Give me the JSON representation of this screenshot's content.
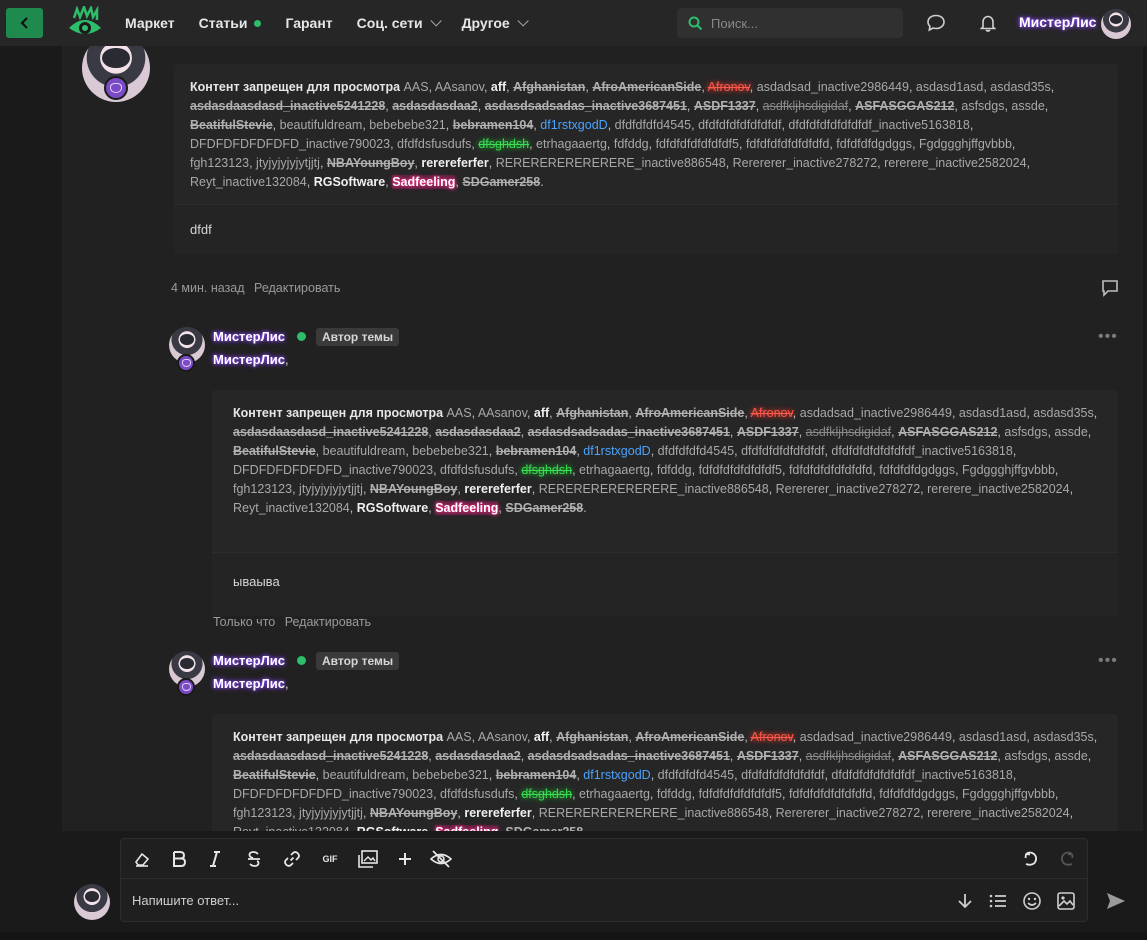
{
  "topbar": {
    "nav": [
      {
        "label": "Маркет"
      },
      {
        "label": "Статьи"
      },
      {
        "label": "Гарант"
      },
      {
        "label": "Соц. сети"
      },
      {
        "label": "Другое"
      }
    ],
    "search_placeholder": "Поиск...",
    "username": "МистерЛис"
  },
  "quote_users": {
    "intro": "Контент запрещен для просмотра",
    "list": [
      {
        "t": "AAS",
        "s": "grey"
      },
      {
        "t": "AAsanov",
        "s": "grey"
      },
      {
        "t": "aff",
        "s": "white"
      },
      {
        "t": "Afghanistan",
        "s": "strike"
      },
      {
        "t": "AfroAmericanSide",
        "s": "strike"
      },
      {
        "t": "Afronov",
        "s": "red"
      },
      {
        "t": "asdadsad_inactive2986449",
        "s": "grey"
      },
      {
        "t": "asdasd1asd",
        "s": "grey"
      },
      {
        "t": "asdasd35s",
        "s": "grey"
      },
      {
        "t": "asdasdaasdasd_inactive5241228",
        "s": "strike"
      },
      {
        "t": "asdasdasdaa2",
        "s": "strike"
      },
      {
        "t": "asdasdsadsadas_inactive3687451",
        "s": "strike"
      },
      {
        "t": "ASDF1337",
        "s": "strike"
      },
      {
        "t": "asdfkljhsdigidaf",
        "s": "strikegrey"
      },
      {
        "t": "ASFASGGAS212",
        "s": "strike"
      },
      {
        "t": "asfsdgs",
        "s": "grey"
      },
      {
        "t": "assde",
        "s": "grey"
      },
      {
        "t": "BeatifulStevie",
        "s": "strike"
      },
      {
        "t": "beautifuldream",
        "s": "grey"
      },
      {
        "t": "bebebebe321",
        "s": "grey"
      },
      {
        "t": "bebramen104",
        "s": "strike"
      },
      {
        "t": "df1rstxgodD",
        "s": "blue"
      },
      {
        "t": "dfdfdfdfd4545",
        "s": "grey"
      },
      {
        "t": "dfdfdfdfdfdfdfdf",
        "s": "grey"
      },
      {
        "t": "dfdfdfdfdfdfdfdf_inactive5163818",
        "s": "grey"
      },
      {
        "t": "DFDFDFDFDFDFD_inactive790023",
        "s": "grey"
      },
      {
        "t": "dfdfdsfusdufs",
        "s": "grey"
      },
      {
        "t": "dfsghdsh",
        "s": "green"
      },
      {
        "t": "etrhagaaertg",
        "s": "grey"
      },
      {
        "t": "fdfddg",
        "s": "grey"
      },
      {
        "t": "fdfdfdfdfdfdfdf5",
        "s": "grey"
      },
      {
        "t": "fdfdfdfdfdfdfdfd",
        "s": "grey"
      },
      {
        "t": "fdfdfdfdgdggs",
        "s": "grey"
      },
      {
        "t": "Fgdggghjffgvbbb",
        "s": "grey"
      },
      {
        "t": "fgh123123",
        "s": "grey"
      },
      {
        "t": "jtyjyjyjyjytjjtj",
        "s": "grey"
      },
      {
        "t": "NBAYoungBoy",
        "s": "strike"
      },
      {
        "t": "rerereferfer",
        "s": "white"
      },
      {
        "t": "RERERERERERERERE_inactive886548",
        "s": "grey"
      },
      {
        "t": "Rerererer_inactive278272",
        "s": "grey"
      },
      {
        "t": "rererere_inactive2582024",
        "s": "grey"
      },
      {
        "t": "Reyt_inactive132084",
        "s": "grey"
      },
      {
        "t": "RGSoftware",
        "s": "white"
      },
      {
        "t": "Sadfeeling",
        "s": "pink"
      },
      {
        "t": "SDGamer258",
        "s": "strike"
      }
    ]
  },
  "posts": [
    {
      "inner_text": "dfdf",
      "time": "4 мин. назад",
      "edit": "Редактировать"
    },
    {
      "author": "МистерЛис",
      "tag": "Автор темы",
      "mention": "МистерЛис",
      "inner_text": "ываыва",
      "time": "Только что",
      "edit": "Редактировать"
    },
    {
      "author": "МистерЛис",
      "tag": "Автор темы",
      "mention": "МистерЛис"
    }
  ],
  "editor": {
    "placeholder": "Напишите ответ...",
    "gif_label": "GIF"
  },
  "colors": {
    "accent": "#1e8a4e",
    "online": "#2ebd6b",
    "nick_glow": "#8a45ff"
  }
}
